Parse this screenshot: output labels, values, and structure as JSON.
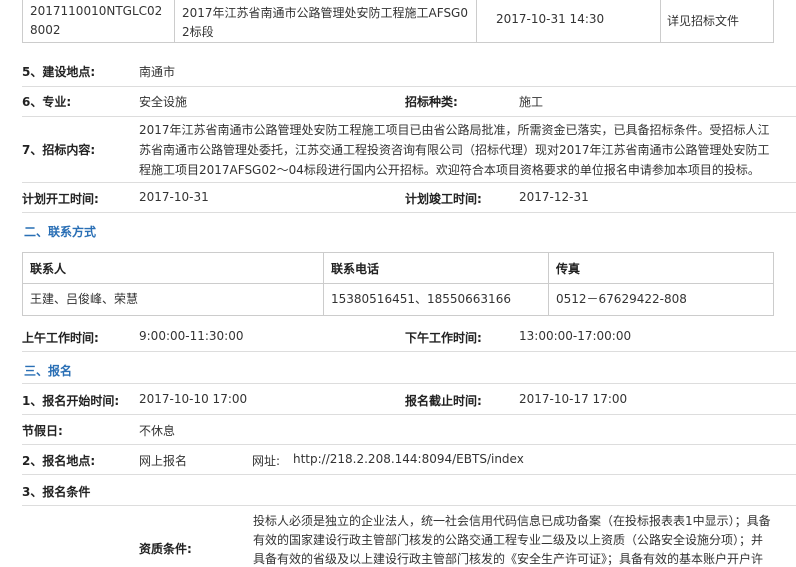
{
  "top_row": {
    "code_line1": "2017110010NTGLC02",
    "code_line2": "8002",
    "name_line1": "2017年江苏省南通市公路管理处安防工程施工AFSG0",
    "name_line2": "2标段",
    "datetime": "2017-10-31 14:30",
    "note": "详见招标文件"
  },
  "fields": {
    "location_label": "5、建设地点:",
    "location_value": "南通市",
    "specialty_label": "6、专业:",
    "specialty_value": "安全设施",
    "tender_type_label": "招标种类:",
    "tender_type_value": "施工",
    "content_label": "7、招标内容:",
    "content_line1": "2017年江苏省南通市公路管理处安防工程施工项目已由省公路局批准，所需资金已落实，已具备招标条件。受招标人江",
    "content_line2": "苏省南通市公路管理处委托，江苏交通工程投资咨询有限公司（招标代理）现对2017年江苏省南通市公路管理处安防工",
    "content_line3": "程施工项目2017AFSG02～04标段进行国内公开招标。欢迎符合本项目资格要求的单位报名申请参加本项目的投标。",
    "start_label": "计划开工时间:",
    "start_value": "2017-10-31",
    "end_label": "计划竣工时间:",
    "end_value": "2017-12-31"
  },
  "contact": {
    "section_title": "二、联系方式",
    "headers": [
      "联系人",
      "联系电话",
      "传真"
    ],
    "person": "王建、吕俊峰、荣慧",
    "phone": "15380516451、18550663166",
    "fax": "0512－67629422-808",
    "am_label": "上午工作时间:",
    "am_value": "9:00:00-11:30:00",
    "pm_label": "下午工作时间:",
    "pm_value": "13:00:00-17:00:00"
  },
  "registration": {
    "section_title": "三、报名",
    "start_label": "1、报名开始时间:",
    "start_value": "2017-10-10 17:00",
    "deadline_label": "报名截止时间:",
    "deadline_value": "2017-10-17 17:00",
    "holiday_label": "节假日:",
    "holiday_value": "不休息",
    "place_label": "2、报名地点:",
    "place_value": "网上报名",
    "url_label": "网址:",
    "url_value": "http://218.2.208.144:8094/EBTS/index",
    "conditions_label": "3、报名条件",
    "qual_label": "资质条件:",
    "qual_line1": "投标人必须是独立的企业法人，统一社会信用代码信息已成功备案（在投标报表表1中显示）；具备",
    "qual_line2": "有效的国家建设行政主管部门核发的公路交通工程专业二级及以上资质（公路安全设施分项）；并",
    "qual_line3": "具备有效的省级及以上建设行政主管部门核发的《安全生产许可证》；具备有效的基本账户开户许"
  }
}
